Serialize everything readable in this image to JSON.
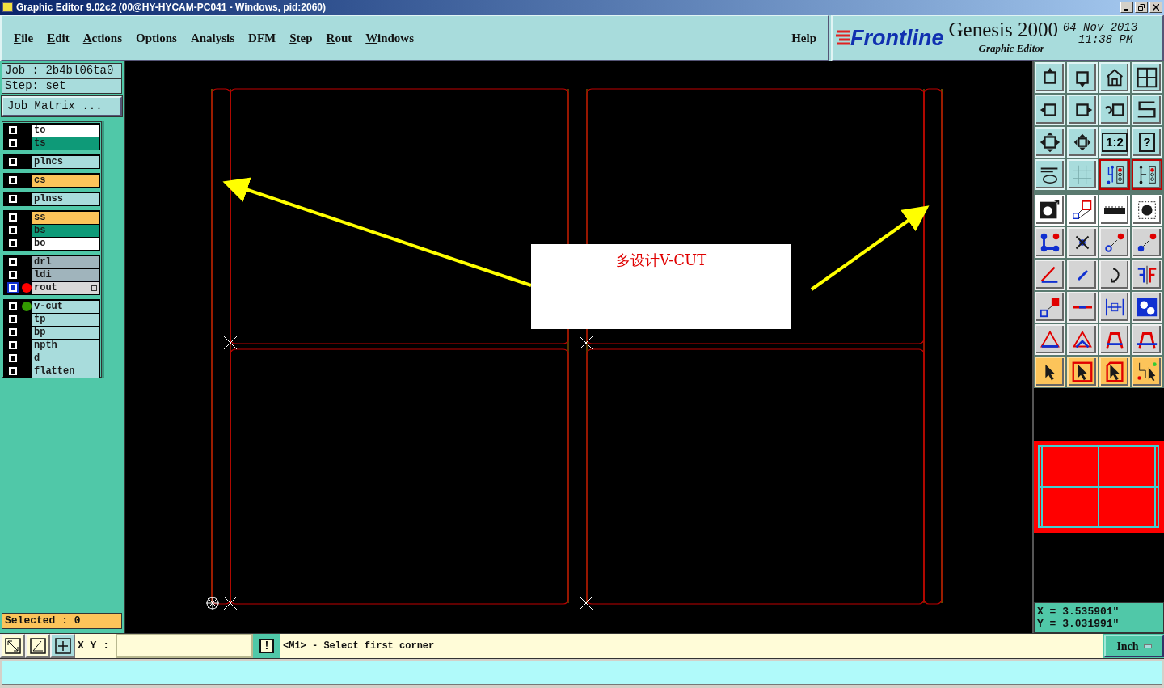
{
  "window": {
    "title": "Graphic Editor 9.02c2 (00@HY-HYCAM-PC041 - Windows, pid:2060)"
  },
  "menu": [
    {
      "label": "File",
      "underline_first": true
    },
    {
      "label": "Edit",
      "underline_first": true
    },
    {
      "label": "Actions",
      "underline_first": true
    },
    {
      "label": "Options",
      "underline_first": false
    },
    {
      "label": "Analysis",
      "underline_first": false
    },
    {
      "label": "DFM",
      "underline_first": false
    },
    {
      "label": "Step",
      "underline_first": true
    },
    {
      "label": "Rout",
      "underline_first": true
    },
    {
      "label": "Windows",
      "underline_first": true
    }
  ],
  "help": "Help",
  "brand": {
    "logo": "Frontline",
    "product": "Genesis 2000",
    "subtitle": "Graphic Editor",
    "date": "04 Nov 2013",
    "time": "11:38 PM"
  },
  "job": "Job : 2b4bl06ta0",
  "step": "Step: set",
  "job_matrix": "Job Matrix ...",
  "layer_groups": [
    {
      "layers": [
        {
          "name": "to",
          "color": "#ffffff",
          "selected": false
        },
        {
          "name": "ts",
          "color": "#0e9a78",
          "selected": false
        }
      ]
    },
    {
      "layers": [
        {
          "name": "plncs",
          "color": "#a8dcdc",
          "selected": false
        }
      ]
    },
    {
      "layers": [
        {
          "name": "cs",
          "color": "#fcc45a",
          "selected": false
        }
      ]
    },
    {
      "layers": [
        {
          "name": "plnss",
          "color": "#a8dcdc",
          "selected": false
        }
      ]
    },
    {
      "layers": [
        {
          "name": "ss",
          "color": "#fcc45a",
          "selected": false
        },
        {
          "name": "bs",
          "color": "#0e9a78",
          "selected": false
        },
        {
          "name": "bo",
          "color": "#ffffff",
          "selected": false
        }
      ]
    },
    {
      "layers": [
        {
          "name": "drl",
          "color": "#a0b4bc",
          "selected": false
        },
        {
          "name": "ldi",
          "color": "#a0b4bc",
          "selected": false
        },
        {
          "name": "rout",
          "color": "#d8d8d8",
          "selected": true,
          "dot": {
            "color": "#ff0000"
          }
        }
      ]
    },
    {
      "layers": [
        {
          "name": "v-cut",
          "color": "#a8dcdc",
          "selected": false,
          "dot": {
            "color": "#339900"
          }
        },
        {
          "name": "tp",
          "color": "#a8dcdc",
          "selected": false
        },
        {
          "name": "bp",
          "color": "#a8dcdc",
          "selected": false
        },
        {
          "name": "npth",
          "color": "#a8dcdc",
          "selected": false
        },
        {
          "name": "d",
          "color": "#a8dcdc",
          "selected": false
        },
        {
          "name": "flatten",
          "color": "#a8dcdc",
          "selected": false
        }
      ]
    }
  ],
  "selected_count": "Selected : 0",
  "annotation": "多设计V-CUT",
  "toolbar": {
    "scale_label": "1:2",
    "help_label": "?"
  },
  "coordinates": {
    "x": "X = 3.535901\"",
    "y": "Y = 3.031991\""
  },
  "command": {
    "xy_label": "X Y :",
    "confirm": "!",
    "message": "<M1> - Select first corner",
    "units": "Inch"
  }
}
